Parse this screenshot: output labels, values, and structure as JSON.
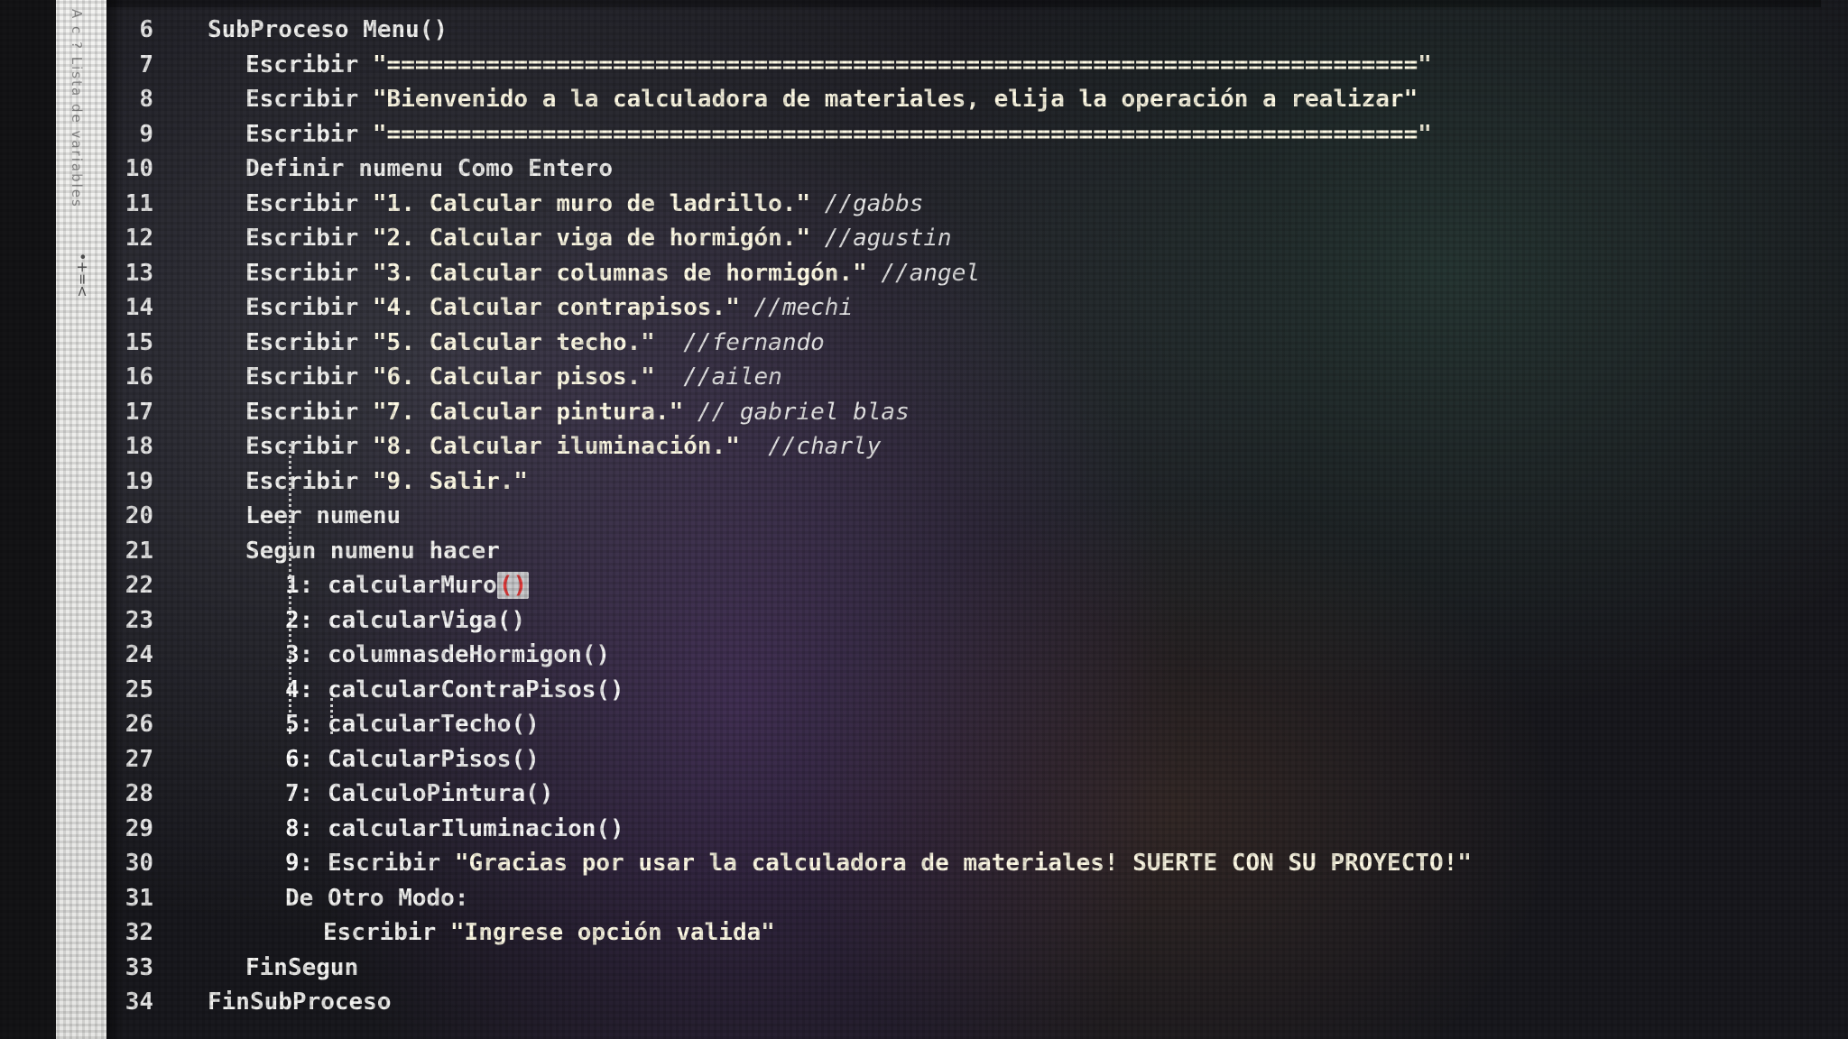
{
  "side_panel": {
    "text": "A c ? Lista de variables",
    "symbols": "•+=<"
  },
  "lines": [
    {
      "n": "6",
      "indent": 0,
      "parts": [
        {
          "t": "kw",
          "v": "SubProceso Menu()"
        }
      ]
    },
    {
      "n": "7",
      "indent": 1,
      "parts": [
        {
          "t": "kw",
          "v": "Escribir "
        },
        {
          "t": "str",
          "v": "\"=========================================================================\""
        }
      ]
    },
    {
      "n": "8",
      "indent": 1,
      "parts": [
        {
          "t": "kw",
          "v": "Escribir "
        },
        {
          "t": "str",
          "v": "\"Bienvenido a la calculadora de materiales, elija la operación a realizar\""
        }
      ]
    },
    {
      "n": "9",
      "indent": 1,
      "parts": [
        {
          "t": "kw",
          "v": "Escribir "
        },
        {
          "t": "str",
          "v": "\"=========================================================================\""
        }
      ]
    },
    {
      "n": "10",
      "indent": 1,
      "parts": [
        {
          "t": "kw",
          "v": "Definir numenu Como Entero"
        }
      ]
    },
    {
      "n": "11",
      "indent": 1,
      "parts": [
        {
          "t": "kw",
          "v": "Escribir "
        },
        {
          "t": "str",
          "v": "\"1. Calcular muro de ladrillo.\" "
        },
        {
          "t": "cm",
          "v": "//gabbs"
        }
      ]
    },
    {
      "n": "12",
      "indent": 1,
      "parts": [
        {
          "t": "kw",
          "v": "Escribir "
        },
        {
          "t": "str",
          "v": "\"2. Calcular viga de hormigón.\" "
        },
        {
          "t": "cm",
          "v": "//agustin"
        }
      ]
    },
    {
      "n": "13",
      "indent": 1,
      "parts": [
        {
          "t": "kw",
          "v": "Escribir "
        },
        {
          "t": "str",
          "v": "\"3. Calcular columnas de hormigón.\" "
        },
        {
          "t": "cm",
          "v": "//angel"
        }
      ]
    },
    {
      "n": "14",
      "indent": 1,
      "parts": [
        {
          "t": "kw",
          "v": "Escribir "
        },
        {
          "t": "str",
          "v": "\"4. Calcular contrapisos.\" "
        },
        {
          "t": "cm",
          "v": "//mechi"
        }
      ]
    },
    {
      "n": "15",
      "indent": 1,
      "parts": [
        {
          "t": "kw",
          "v": "Escribir "
        },
        {
          "t": "str",
          "v": "\"5. Calcular techo.\"  "
        },
        {
          "t": "cm",
          "v": "//fernando"
        }
      ]
    },
    {
      "n": "16",
      "indent": 1,
      "parts": [
        {
          "t": "kw",
          "v": "Escribir "
        },
        {
          "t": "str",
          "v": "\"6. Calcular pisos.\"  "
        },
        {
          "t": "cm",
          "v": "//ailen"
        }
      ]
    },
    {
      "n": "17",
      "indent": 1,
      "parts": [
        {
          "t": "kw",
          "v": "Escribir "
        },
        {
          "t": "str",
          "v": "\"7. Calcular pintura.\" "
        },
        {
          "t": "cm",
          "v": "// gabriel blas"
        }
      ]
    },
    {
      "n": "18",
      "indent": 1,
      "parts": [
        {
          "t": "kw",
          "v": "Escribir "
        },
        {
          "t": "str",
          "v": "\"8. Calcular iluminación.\"  "
        },
        {
          "t": "cm",
          "v": "//charly"
        }
      ]
    },
    {
      "n": "19",
      "indent": 1,
      "parts": [
        {
          "t": "kw",
          "v": "Escribir "
        },
        {
          "t": "str",
          "v": "\"9. Salir.\""
        }
      ]
    },
    {
      "n": "20",
      "indent": 1,
      "parts": [
        {
          "t": "kw",
          "v": "Leer numenu"
        }
      ]
    },
    {
      "n": "21",
      "indent": 1,
      "parts": [
        {
          "t": "kw",
          "v": "Segun numenu hacer"
        }
      ]
    },
    {
      "n": "22",
      "indent": 2,
      "parts": [
        {
          "t": "num",
          "v": "1: "
        },
        {
          "t": "fn",
          "v": "calcularMuro"
        },
        {
          "t": "cursor",
          "v": "()"
        }
      ]
    },
    {
      "n": "23",
      "indent": 2,
      "parts": [
        {
          "t": "num",
          "v": "2: "
        },
        {
          "t": "fn",
          "v": "calcularViga()"
        }
      ]
    },
    {
      "n": "24",
      "indent": 2,
      "parts": [
        {
          "t": "num",
          "v": "3: "
        },
        {
          "t": "fn",
          "v": "columnasdeHormigon()"
        }
      ]
    },
    {
      "n": "25",
      "indent": 2,
      "parts": [
        {
          "t": "num",
          "v": "4: "
        },
        {
          "t": "fn",
          "v": "calcularContraPisos()"
        }
      ]
    },
    {
      "n": "26",
      "indent": 2,
      "parts": [
        {
          "t": "num",
          "v": "5: "
        },
        {
          "t": "fn",
          "v": "calcularTecho()"
        }
      ]
    },
    {
      "n": "27",
      "indent": 2,
      "parts": [
        {
          "t": "num",
          "v": "6: "
        },
        {
          "t": "fn",
          "v": "CalcularPisos()"
        }
      ]
    },
    {
      "n": "28",
      "indent": 2,
      "parts": [
        {
          "t": "num",
          "v": "7: "
        },
        {
          "t": "fn",
          "v": "CalculoPintura()"
        }
      ]
    },
    {
      "n": "29",
      "indent": 2,
      "parts": [
        {
          "t": "num",
          "v": "8: "
        },
        {
          "t": "fn",
          "v": "calcularIluminacion()"
        }
      ]
    },
    {
      "n": "30",
      "indent": 2,
      "parts": [
        {
          "t": "num",
          "v": "9: "
        },
        {
          "t": "kw",
          "v": "Escribir "
        },
        {
          "t": "str",
          "v": "\"Gracias por usar la calculadora de materiales! SUERTE CON SU PROYECTO!\""
        }
      ]
    },
    {
      "n": "31",
      "indent": 2,
      "parts": [
        {
          "t": "kw",
          "v": "De Otro Modo:"
        }
      ]
    },
    {
      "n": "32",
      "indent": 3,
      "parts": [
        {
          "t": "kw",
          "v": "Escribir "
        },
        {
          "t": "str",
          "v": "\"Ingrese opción valida\""
        }
      ]
    },
    {
      "n": "33",
      "indent": 1,
      "parts": [
        {
          "t": "kw",
          "v": "FinSegun"
        }
      ]
    },
    {
      "n": "34",
      "indent": 0,
      "parts": [
        {
          "t": "kw",
          "v": "FinSubProceso"
        }
      ]
    }
  ]
}
